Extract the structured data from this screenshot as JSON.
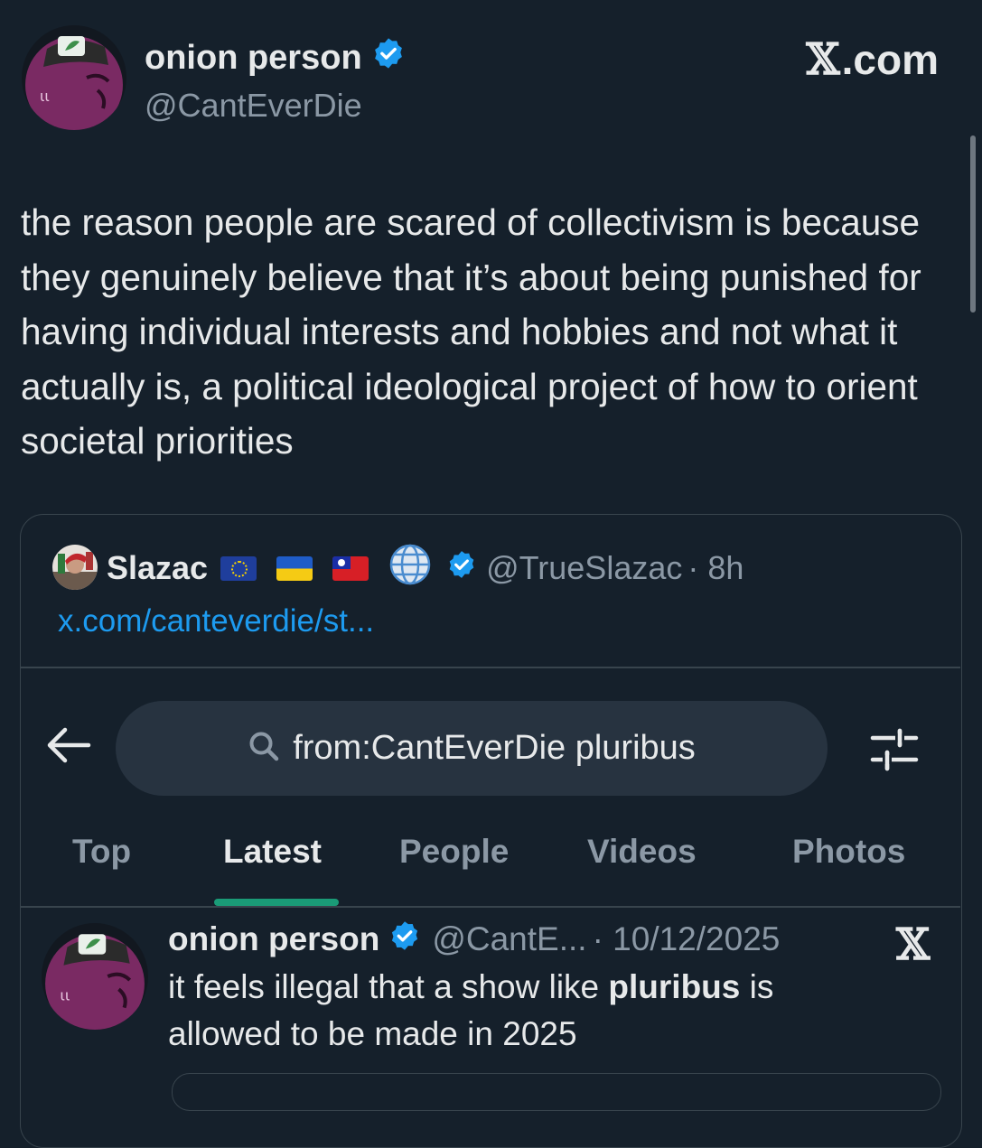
{
  "colors": {
    "background": "#15202b",
    "text_primary": "#e7e9ea",
    "text_secondary": "#8b98a5",
    "link": "#1d9bf0",
    "verified": "#1d9bf0",
    "tab_indicator": "#1a9b77",
    "search_bg": "#273340",
    "border": "#38444d"
  },
  "tweet": {
    "author_name": "onion person",
    "author_handle": "@CantEverDie",
    "site_label": ".com",
    "text": "the reason people are scared of collectivism is because they genuinely believe that it’s about being punished for having individual interests and hobbies and not what it actually is, a political ideological project of how to orient societal priorities"
  },
  "quote": {
    "author_name": "Slazac",
    "author_handle": "@TrueSlazac",
    "time": "· 8h",
    "link_text": "x.com/canteverdie/st...",
    "badges": [
      "eu-flag-icon",
      "ukraine-flag-icon",
      "taiwan-flag-icon",
      "globe-icon"
    ]
  },
  "screenshot": {
    "search_query": "from:CantEverDie pluribus",
    "tabs": [
      "Top",
      "Latest",
      "People",
      "Videos",
      "Photos"
    ],
    "active_tab": "Latest",
    "result": {
      "author_name": "onion person",
      "author_handle": "@CantE...",
      "date": "· 10/12/2025",
      "text_before": "it feels illegal that a show like ",
      "text_bold": "pluribus",
      "text_after": " is allowed to be made in 2025"
    }
  }
}
